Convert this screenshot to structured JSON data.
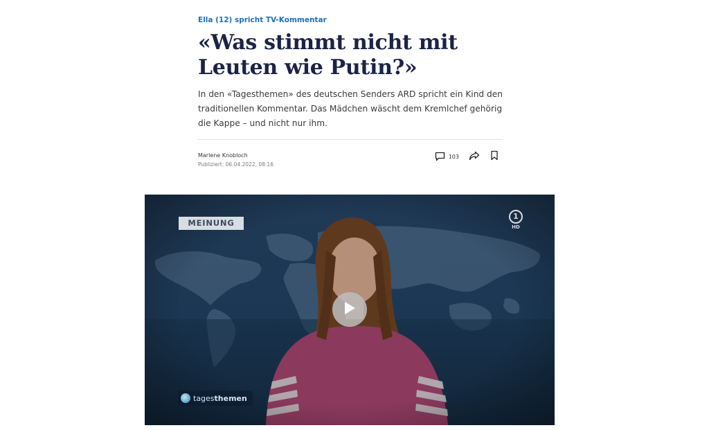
{
  "article": {
    "kicker": "Ella (12) spricht TV-Kommentar",
    "headline_line1": "«Was stimmt nicht mit",
    "headline_line2": "Leuten wie Putin?»",
    "lead": "In den «Tagesthemen» des deutschen Senders ARD spricht ein Kind den traditionellen Kommentar. Das Mädchen wäscht dem Kremlchef gehörig die Kappe – und nicht nur ihm."
  },
  "meta": {
    "author": "Marlene Knobloch",
    "published": "Publiziert: 06.04.2022, 08:16",
    "comment_count": "103",
    "comment_icon": "comment-icon",
    "share_icon": "share-icon",
    "bookmark_icon": "bookmark-icon"
  },
  "video": {
    "badge": "MEINUNG",
    "show_name_light": "tages",
    "show_name_bold": "themen",
    "channel_mark": "1",
    "channel_hd": "HD",
    "play_icon": "play-icon"
  },
  "colors": {
    "kicker": "#1f6fb5",
    "headline": "#1b2347"
  }
}
